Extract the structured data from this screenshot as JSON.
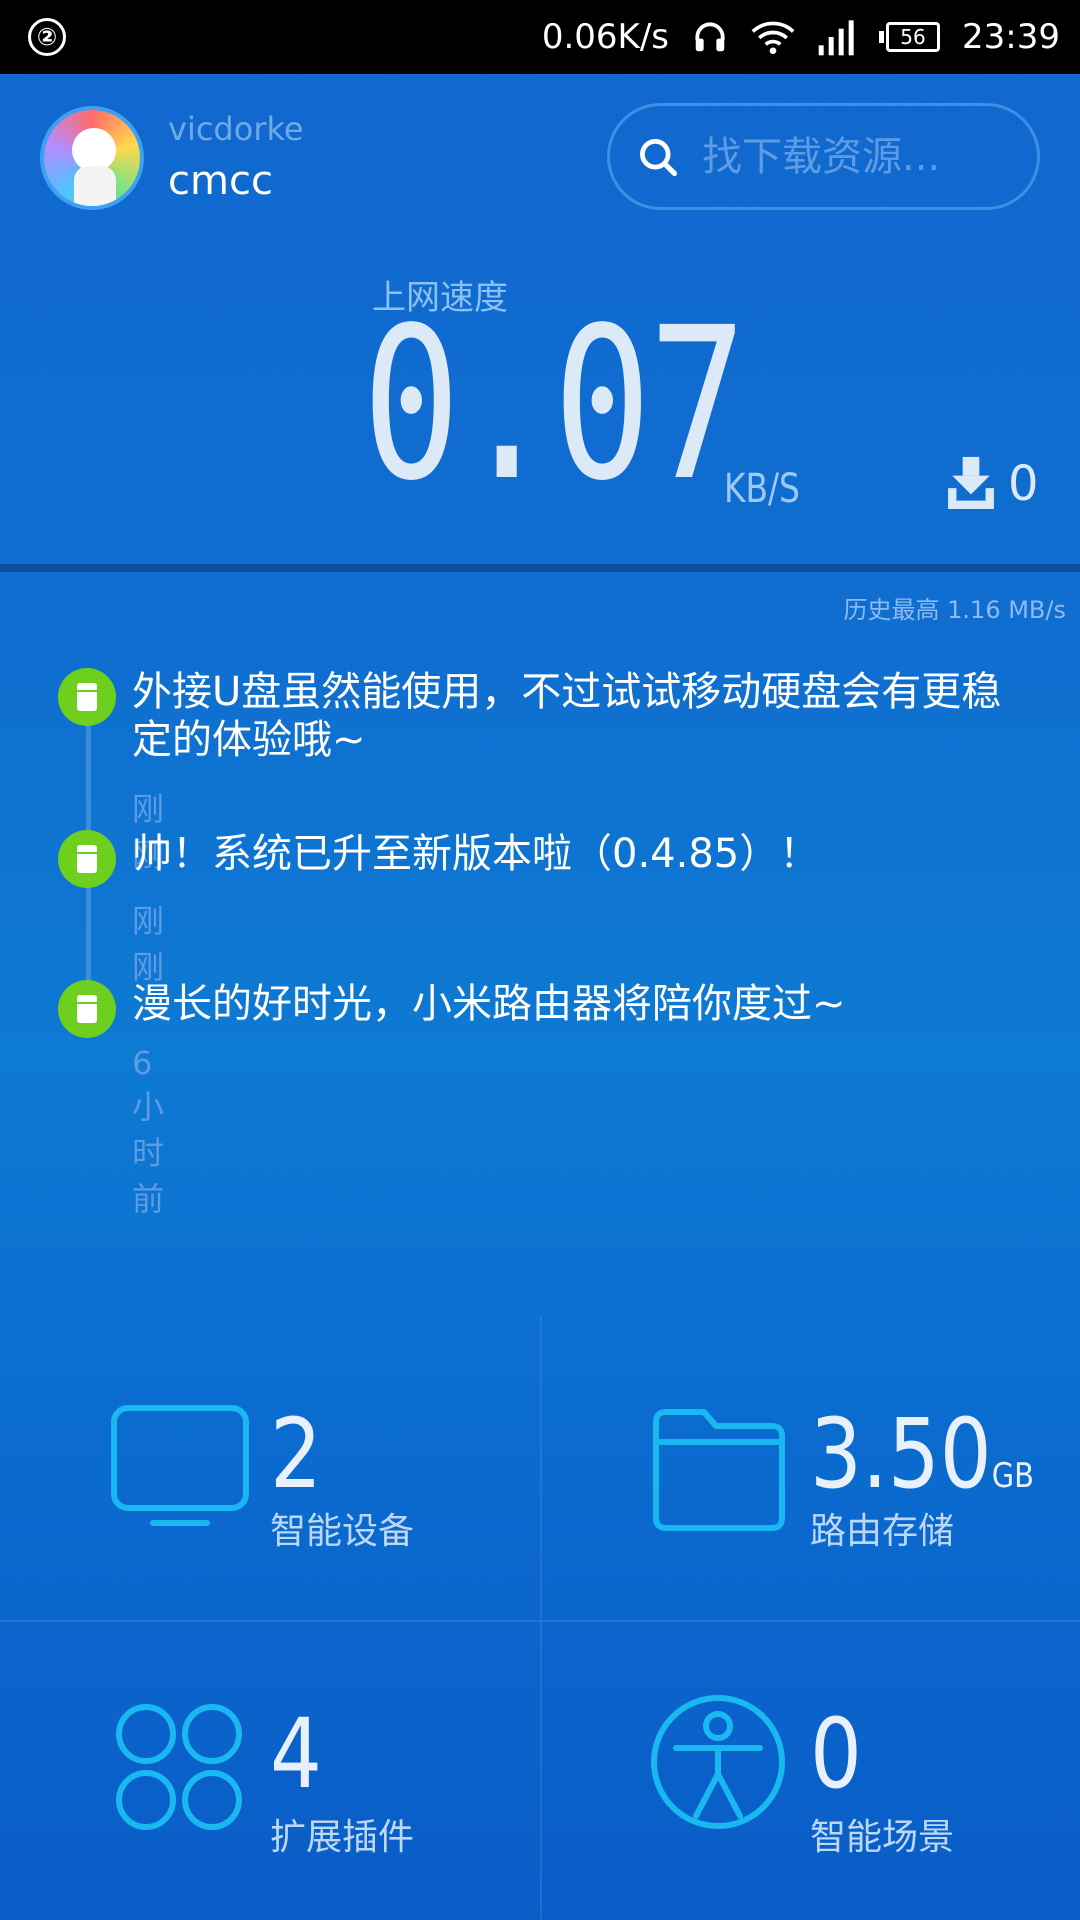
{
  "status_bar": {
    "sim": "②",
    "net_speed": "0.06K/s",
    "battery": "56",
    "time": "23:39"
  },
  "header": {
    "username": "vicdorke",
    "network": "cmcc",
    "search_placeholder": "找下载资源..."
  },
  "speed": {
    "label": "上网速度",
    "value": "0.07",
    "unit": "KB/S",
    "download_count": "0",
    "history_max": "历史最高 1.16 MB/s"
  },
  "timeline": [
    {
      "text": "外接U盘虽然能使用，不过试试移动硬盘会有更稳定的体验哦~",
      "time": "刚刚"
    },
    {
      "text": "帅！系统已升至新版本啦（0.4.85）！",
      "time": "刚刚"
    },
    {
      "text": "漫长的好时光，小米路由器将陪你度过~",
      "time": "6小时前"
    }
  ],
  "tiles": {
    "devices": {
      "value": "2",
      "label": "智能设备"
    },
    "storage": {
      "value": "3.50",
      "unit": "GB",
      "label": "路由存储"
    },
    "plugins": {
      "value": "4",
      "label": "扩展插件"
    },
    "scenes": {
      "value": "0",
      "label": "智能场景"
    }
  },
  "colors": {
    "accent_cyan": "#19b8f0",
    "timeline_green": "#6fcf1f",
    "background_blue": "#0f6fd0"
  },
  "icons": [
    "headphones-icon",
    "wifi-icon",
    "signal-icon",
    "battery-icon",
    "search-icon",
    "download-icon",
    "storage-icon",
    "monitor-icon",
    "folder-icon",
    "plugins-icon",
    "human-icon"
  ]
}
